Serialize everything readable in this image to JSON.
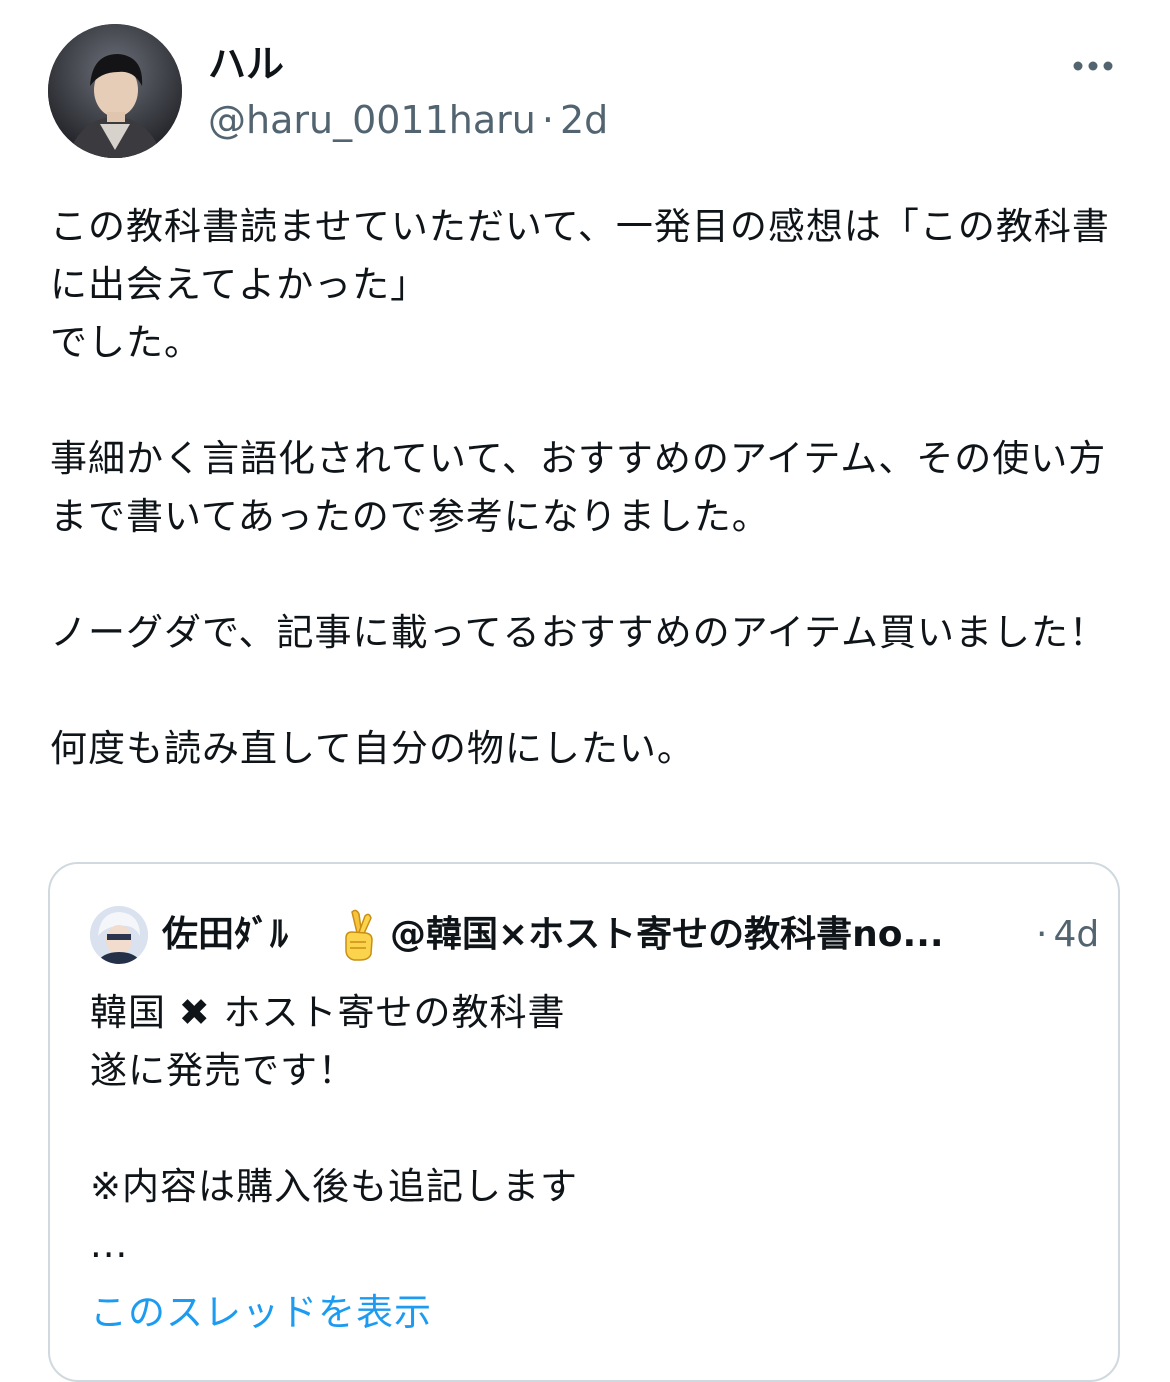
{
  "tweet": {
    "author_name": "ハル",
    "author_handle": "@haru_0011haru",
    "separator": "·",
    "timestamp": "2d",
    "body": "この教科書読ませていただいて、一発目の感想は「この教科書に出会えてよかった」\nでした。\n\n事細かく言語化されていて、おすすめのアイテム、その使い方まで書いてあったので参考になりました。\n\nノーグダで、記事に載ってるおすすめのアイテム買いました！\n\n何度も読み直して自分の物にしたい。",
    "icons": {
      "avatar": "avatar-photo",
      "more": "more-horizontal-icon"
    }
  },
  "quoted_tweet": {
    "author_name": "佐田ﾀﾞﾙ",
    "emoji": "crossed-fingers-emoji",
    "author_handle": "@韓国×ホスト寄せの教科書no...",
    "separator": "·",
    "timestamp": "4d",
    "body": "韓国 ✖ ホスト寄せの教科書\n遂に発売です！\n\n※内容は購入後も追記します\n...",
    "show_thread": "このスレッドを表示"
  },
  "colors": {
    "text": "#0f1419",
    "secondary": "#536471",
    "link": "#1d9bf0",
    "border": "#cfd9de"
  }
}
